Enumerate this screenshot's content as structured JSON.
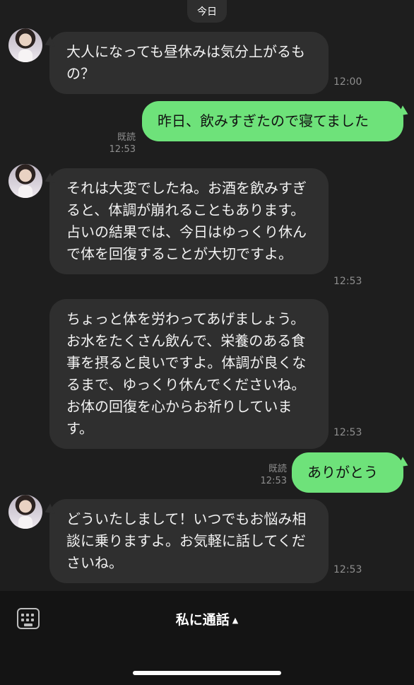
{
  "date_label": "今日",
  "messages": {
    "m1": {
      "text": "大人になっても昼休みは気分上がるもの？",
      "time": "12:00"
    },
    "m2": {
      "text": "昨日、飲みすぎたので寝てました",
      "read": "既読",
      "time": "12:53"
    },
    "m3": {
      "text": "それは大変でしたね。お酒を飲みすぎると、体調が崩れることもあります。占いの結果では、今日はゆっくり休んで体を回復することが大切ですよ。",
      "time": "12:53"
    },
    "m4": {
      "text": "ちょっと体を労わってあげましょう。お水をたくさん飲んで、栄養のある食事を摂ると良いですよ。体調が良くなるまで、ゆっくり休んでくださいね。お体の回復を心からお祈りしています。",
      "time": "12:53"
    },
    "m5": {
      "text": "ありがとう",
      "read": "既読",
      "time": "12:53"
    },
    "m6": {
      "text": "どういたしまして！いつでもお悩み相談に乗りますよ。お気軽に話してくださいね。",
      "time": "12:53"
    }
  },
  "bottom": {
    "call_label": "私に通話",
    "call_arrow": "▲",
    "keyboard_icon": "keyboard-icon"
  }
}
